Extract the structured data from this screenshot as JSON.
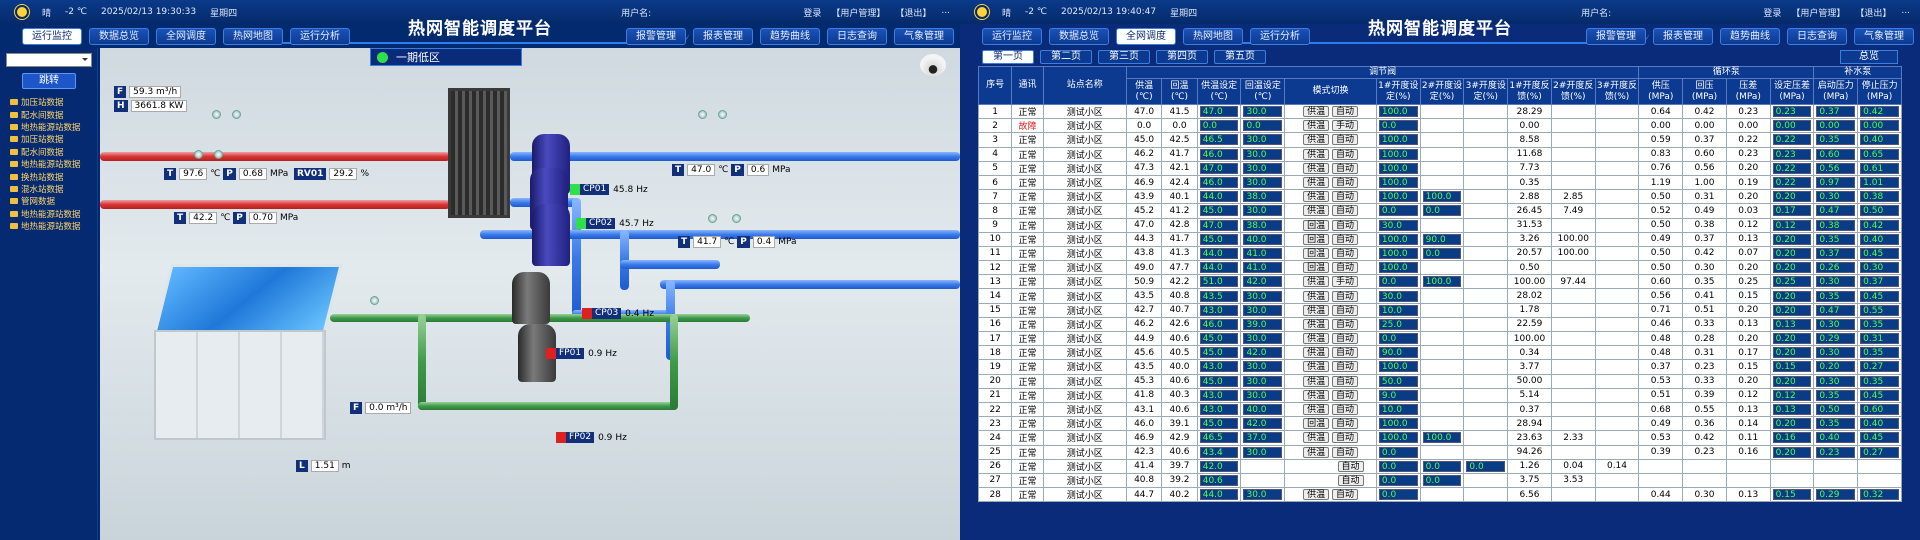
{
  "header": {
    "weather": "晴",
    "temp": "-2 ℃",
    "app_title": "热网智能调度平台",
    "user_label": "用户名:",
    "login": "登录",
    "user_manage": "【用户管理】",
    "logout": "【退出】",
    "dots": "..."
  },
  "screen1": {
    "datetime": "2025/02/13  19:30:33",
    "weekday": "星期四",
    "nav_left": [
      "运行监控",
      "数据总览",
      "全网调度",
      "热网地图",
      "运行分析"
    ],
    "nav_right": [
      "报警管理",
      "报表管理",
      "趋势曲线",
      "日志查询",
      "气象管理"
    ],
    "jump_label": "跳转",
    "tree": [
      "加压站数据",
      "配水间数据",
      "地热能源站数据",
      "加压站数据",
      "配水间数据",
      "地热能源站数据",
      "换热站数据",
      "混水站数据",
      "管网数据",
      "地热能源站数据",
      "地热能源站数据"
    ],
    "zone_name": "一期低区",
    "readings": {
      "flow_in": "59.3 m³/h",
      "heat": "3661.8 KW",
      "t1": "97.6",
      "p1": "0.68",
      "t2": "42.2",
      "p2": "0.70",
      "rv01_label": "RV01",
      "rv01": "29.2",
      "t3": "47.0",
      "p3": "0.6",
      "t4": "41.7",
      "p4": "0.4",
      "flow_makeup": "0.0 m³/h",
      "level": "1.51"
    },
    "units": {
      "temp": "℃",
      "press": "MPa",
      "pct": "%",
      "meter": "m"
    },
    "keys": {
      "F": "F",
      "H": "H",
      "T": "T",
      "P": "P",
      "L": "L"
    },
    "pumps": [
      {
        "name": "CP01",
        "value": "45.8",
        "unit": "Hz",
        "status_color": "#2ee04a"
      },
      {
        "name": "CP02",
        "value": "45.7",
        "unit": "Hz",
        "status_color": "#2ee04a"
      },
      {
        "name": "CP03",
        "value": "0.4",
        "unit": "Hz",
        "status_color": "#e02020"
      },
      {
        "name": "FP01",
        "value": "0.9",
        "unit": "Hz",
        "status_color": "#e02020"
      },
      {
        "name": "FP02",
        "value": "0.9",
        "unit": "Hz",
        "status_color": "#e02020"
      }
    ]
  },
  "screen2": {
    "datetime": "2025/02/13  19:40:47",
    "weekday": "星期四",
    "tabs": [
      "第一页",
      "第二页",
      "第三页",
      "第四页",
      "第五页"
    ],
    "tab_right": "总览",
    "group_headers": {
      "valve": "调节阀",
      "circ": "循环泵",
      "makeup": "补水泵"
    },
    "columns": [
      "序号",
      "通讯",
      "站点名称",
      "供温(℃)",
      "回温(℃)",
      "供温设定(℃)",
      "回温设定(℃)",
      "模式切换",
      "1#开度设定(%)",
      "2#开度设定(%)",
      "3#开度设定(%)",
      "1#开度反馈(%)",
      "2#开度反馈(%)",
      "3#开度反馈(%)",
      "供压(MPa)",
      "回压(MPa)",
      "压差(MPa)",
      "设定压差(MPa)",
      "启动压力(MPa)",
      "停止压力(MPa)"
    ],
    "rows": [
      [
        "1",
        "正常",
        "测试小区",
        "47.0",
        "41.5",
        "47.0",
        "30.0",
        "供温",
        "自动",
        "100.0",
        "",
        "",
        "28.29",
        "",
        "",
        "0.64",
        "0.42",
        "0.23",
        "0.23",
        "0.37",
        "0.42"
      ],
      [
        "2",
        "故障",
        "测试小区",
        "0.0",
        "0.0",
        "0.0",
        "0.0",
        "供温",
        "手动",
        "0.0",
        "",
        "",
        "0.00",
        "",
        "",
        "0.00",
        "0.00",
        "0.00",
        "0.00",
        "0.00",
        "0.00"
      ],
      [
        "3",
        "正常",
        "测试小区",
        "45.0",
        "42.5",
        "46.5",
        "30.0",
        "供温",
        "自动",
        "100.0",
        "",
        "",
        "8.58",
        "",
        "",
        "0.59",
        "0.37",
        "0.22",
        "0.22",
        "0.35",
        "0.40"
      ],
      [
        "4",
        "正常",
        "测试小区",
        "46.2",
        "41.7",
        "46.0",
        "30.0",
        "供温",
        "自动",
        "100.0",
        "",
        "",
        "11.68",
        "",
        "",
        "0.83",
        "0.60",
        "0.23",
        "0.23",
        "0.60",
        "0.65"
      ],
      [
        "5",
        "正常",
        "测试小区",
        "47.3",
        "42.1",
        "47.0",
        "30.0",
        "供温",
        "自动",
        "100.0",
        "",
        "",
        "7.73",
        "",
        "",
        "0.76",
        "0.56",
        "0.20",
        "0.22",
        "0.56",
        "0.61"
      ],
      [
        "6",
        "正常",
        "测试小区",
        "46.9",
        "42.4",
        "46.0",
        "30.0",
        "供温",
        "自动",
        "100.0",
        "",
        "",
        "0.35",
        "",
        "",
        "1.19",
        "1.00",
        "0.19",
        "0.22",
        "0.97",
        "1.01"
      ],
      [
        "7",
        "正常",
        "测试小区",
        "43.9",
        "40.1",
        "44.0",
        "38.0",
        "供温",
        "自动",
        "100.0",
        "100.0",
        "",
        "2.88",
        "2.85",
        "",
        "0.50",
        "0.31",
        "0.20",
        "0.20",
        "0.30",
        "0.38"
      ],
      [
        "8",
        "正常",
        "测试小区",
        "45.2",
        "41.2",
        "45.0",
        "30.0",
        "供温",
        "自动",
        "0.0",
        "0.0",
        "",
        "26.45",
        "7.49",
        "",
        "0.52",
        "0.49",
        "0.03",
        "0.17",
        "0.47",
        "0.50"
      ],
      [
        "9",
        "正常",
        "测试小区",
        "47.0",
        "42.8",
        "47.0",
        "38.0",
        "回温",
        "自动",
        "30.0",
        "",
        "",
        "31.53",
        "",
        "",
        "0.50",
        "0.38",
        "0.12",
        "0.12",
        "0.38",
        "0.42"
      ],
      [
        "10",
        "正常",
        "测试小区",
        "44.3",
        "41.7",
        "45.0",
        "40.0",
        "回温",
        "自动",
        "100.0",
        "90.0",
        "",
        "3.26",
        "100.00",
        "",
        "0.49",
        "0.37",
        "0.13",
        "0.20",
        "0.35",
        "0.40"
      ],
      [
        "11",
        "正常",
        "测试小区",
        "43.8",
        "41.3",
        "44.0",
        "41.0",
        "回温",
        "自动",
        "100.0",
        "0.0",
        "",
        "20.57",
        "100.00",
        "",
        "0.50",
        "0.42",
        "0.07",
        "0.20",
        "0.37",
        "0.45"
      ],
      [
        "12",
        "正常",
        "测试小区",
        "49.0",
        "47.7",
        "44.0",
        "41.0",
        "回温",
        "自动",
        "100.0",
        "",
        "",
        "0.50",
        "",
        "",
        "0.50",
        "0.30",
        "0.20",
        "0.20",
        "0.26",
        "0.30"
      ],
      [
        "13",
        "正常",
        "测试小区",
        "50.9",
        "42.2",
        "51.0",
        "42.0",
        "供温",
        "手动",
        "0.0",
        "100.0",
        "",
        "100.00",
        "97.44",
        "",
        "0.60",
        "0.35",
        "0.25",
        "0.25",
        "0.30",
        "0.37"
      ],
      [
        "14",
        "正常",
        "测试小区",
        "43.5",
        "40.8",
        "43.5",
        "30.0",
        "供温",
        "自动",
        "30.0",
        "",
        "",
        "28.02",
        "",
        "",
        "0.56",
        "0.41",
        "0.15",
        "0.20",
        "0.35",
        "0.45"
      ],
      [
        "15",
        "正常",
        "测试小区",
        "42.7",
        "40.7",
        "43.0",
        "30.0",
        "供温",
        "自动",
        "10.0",
        "",
        "",
        "1.78",
        "",
        "",
        "0.71",
        "0.51",
        "0.20",
        "0.20",
        "0.47",
        "0.55"
      ],
      [
        "16",
        "正常",
        "测试小区",
        "46.2",
        "42.6",
        "46.0",
        "39.0",
        "供温",
        "自动",
        "25.0",
        "",
        "",
        "22.59",
        "",
        "",
        "0.46",
        "0.33",
        "0.13",
        "0.13",
        "0.30",
        "0.35"
      ],
      [
        "17",
        "正常",
        "测试小区",
        "44.9",
        "40.6",
        "45.0",
        "30.0",
        "供温",
        "自动",
        "0.0",
        "",
        "",
        "100.00",
        "",
        "",
        "0.48",
        "0.28",
        "0.20",
        "0.20",
        "0.29",
        "0.31"
      ],
      [
        "18",
        "正常",
        "测试小区",
        "45.6",
        "40.5",
        "45.0",
        "42.0",
        "供温",
        "自动",
        "90.0",
        "",
        "",
        "0.34",
        "",
        "",
        "0.48",
        "0.31",
        "0.17",
        "0.20",
        "0.30",
        "0.35"
      ],
      [
        "19",
        "正常",
        "测试小区",
        "43.5",
        "40.0",
        "43.0",
        "30.0",
        "供温",
        "自动",
        "100.0",
        "",
        "",
        "3.77",
        "",
        "",
        "0.37",
        "0.23",
        "0.15",
        "0.15",
        "0.20",
        "0.27"
      ],
      [
        "20",
        "正常",
        "测试小区",
        "45.3",
        "40.6",
        "45.0",
        "30.0",
        "供温",
        "自动",
        "50.0",
        "",
        "",
        "50.00",
        "",
        "",
        "0.53",
        "0.33",
        "0.20",
        "0.20",
        "0.30",
        "0.35"
      ],
      [
        "21",
        "正常",
        "测试小区",
        "41.8",
        "40.3",
        "43.0",
        "30.0",
        "供温",
        "自动",
        "9.0",
        "",
        "",
        "5.14",
        "",
        "",
        "0.51",
        "0.39",
        "0.12",
        "0.12",
        "0.35",
        "0.45"
      ],
      [
        "22",
        "正常",
        "测试小区",
        "43.1",
        "40.6",
        "43.0",
        "40.0",
        "供温",
        "自动",
        "10.0",
        "",
        "",
        "0.37",
        "",
        "",
        "0.68",
        "0.55",
        "0.13",
        "0.13",
        "0.50",
        "0.60"
      ],
      [
        "23",
        "正常",
        "测试小区",
        "46.0",
        "39.1",
        "45.0",
        "42.0",
        "回温",
        "自动",
        "100.0",
        "",
        "",
        "28.94",
        "",
        "",
        "0.49",
        "0.36",
        "0.14",
        "0.20",
        "0.35",
        "0.40"
      ],
      [
        "24",
        "正常",
        "测试小区",
        "46.9",
        "42.9",
        "46.5",
        "37.0",
        "供温",
        "自动",
        "100.0",
        "100.0",
        "",
        "23.63",
        "2.33",
        "",
        "0.53",
        "0.42",
        "0.11",
        "0.16",
        "0.40",
        "0.45"
      ],
      [
        "25",
        "正常",
        "测试小区",
        "42.3",
        "40.6",
        "43.4",
        "30.0",
        "供温",
        "自动",
        "0.0",
        "",
        "",
        "94.26",
        "",
        "",
        "0.39",
        "0.23",
        "0.16",
        "0.20",
        "0.23",
        "0.27"
      ],
      [
        "26",
        "正常",
        "测试小区",
        "41.4",
        "39.7",
        "42.0",
        "",
        "",
        "自动",
        "0.0",
        "0.0",
        "0.0",
        "1.26",
        "0.04",
        "0.14",
        "",
        "",
        "",
        "",
        "",
        ""
      ],
      [
        "27",
        "正常",
        "测试小区",
        "40.8",
        "39.2",
        "40.6",
        "",
        "",
        "自动",
        "0.0",
        "0.0",
        "",
        "3.75",
        "3.53",
        "",
        "",
        "",
        "",
        "",
        "",
        ""
      ],
      [
        "28",
        "正常",
        "测试小区",
        "44.7",
        "40.2",
        "44.0",
        "30.0",
        "供温",
        "自动",
        "0.0",
        "",
        "",
        "6.56",
        "",
        "",
        "0.44",
        "0.30",
        "0.13",
        "0.15",
        "0.29",
        "0.32"
      ]
    ]
  }
}
